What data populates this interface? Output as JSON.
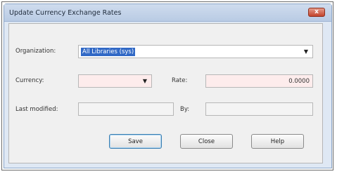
{
  "window": {
    "title": "Update Currency Exchange Rates",
    "close_label": "x"
  },
  "form": {
    "organization": {
      "label": "Organization:",
      "value": "All Libraries (sys)"
    },
    "currency": {
      "label": "Currency:",
      "value": ""
    },
    "rate": {
      "label": "Rate:",
      "value": "0.0000"
    },
    "last_modified": {
      "label": "Last modified:",
      "value": ""
    },
    "by": {
      "label": "By:",
      "value": ""
    }
  },
  "buttons": {
    "save": "Save",
    "close": "Close",
    "help": "Help"
  },
  "colors": {
    "title_bar": "#c9d8ee",
    "required_field": "#fdecec",
    "selection": "#3169c6",
    "close_button": "#c3442c"
  }
}
